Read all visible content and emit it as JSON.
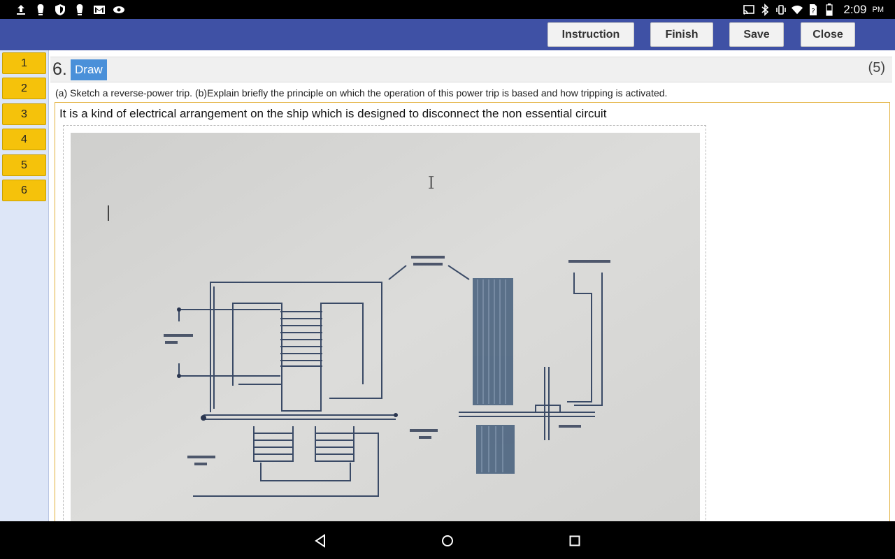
{
  "status_bar": {
    "time": "2:09",
    "ampm": "PM",
    "left_icons": [
      "upload-icon",
      "notification-icon",
      "shield-icon",
      "notification-icon",
      "gmail-icon",
      "eye-icon"
    ],
    "right_icons": [
      "cast-icon",
      "bluetooth-icon",
      "vibrate-icon",
      "wifi-icon",
      "sim-icon",
      "battery-icon"
    ]
  },
  "toolbar": {
    "instruction_label": "Instruction",
    "finish_label": "Finish",
    "save_label": "Save",
    "close_label": "Close"
  },
  "sidebar": {
    "questions": [
      "1",
      "2",
      "3",
      "4",
      "5",
      "6"
    ]
  },
  "question": {
    "number": "6.",
    "type": "Draw",
    "marks": "(5)",
    "text": "(a) Sketch a reverse-power trip. (b)Explain briefly the principle on which the operation of this power trip is based and how tripping is activated."
  },
  "answer": {
    "text": "It is a kind of electrical arrangement on the ship which is designed to disconnect the non essential circuit",
    "image_icon": "reverse-power-trip-sketch"
  },
  "nav_bar": {
    "icons": [
      "back-icon",
      "home-icon",
      "recents-icon"
    ]
  }
}
